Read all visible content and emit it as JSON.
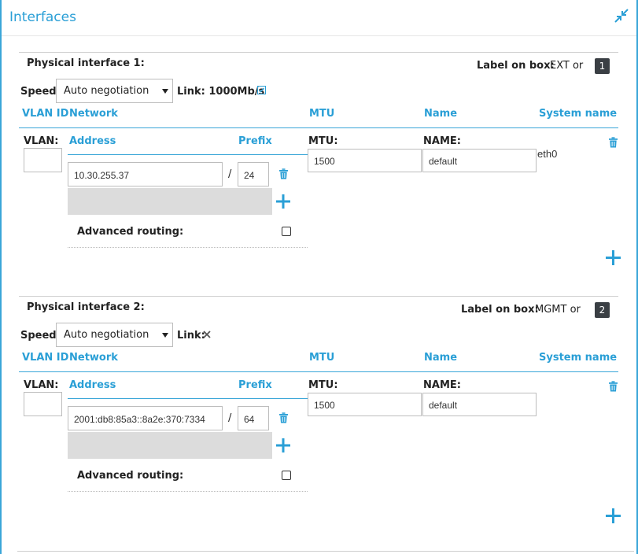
{
  "panel": {
    "title": "Interfaces"
  },
  "columns": {
    "vlan_id": "VLAN ID",
    "network": "Network",
    "mtu": "MTU",
    "name": "Name",
    "system_name": "System name"
  },
  "fields": {
    "vlan": "VLAN:",
    "address": "Address",
    "prefix": "Prefix",
    "mtu": "MTU:",
    "name": "NAME:",
    "speed": "Speed:",
    "link": "Link:",
    "label_on_box": "Label on box:",
    "advanced_routing": "Advanced routing:",
    "slash": "/"
  },
  "interfaces": [
    {
      "title": "Physical interface 1:",
      "label_value": "EXT or",
      "badge": "1",
      "speed": "Auto negotiation",
      "link_text": "1000Mb/s",
      "link_status": "up",
      "vlan": "",
      "address": "10.30.255.37",
      "prefix": "24",
      "mtu": "1500",
      "name": "default",
      "system_name": "eth0",
      "advanced_routing": false
    },
    {
      "title": "Physical interface 2:",
      "label_value": "MGMT or",
      "badge": "2",
      "speed": "Auto negotiation",
      "link_text": "",
      "link_status": "down",
      "vlan": "",
      "address": "2001:db8:85a3::8a2e:370:7334",
      "prefix": "64",
      "mtu": "1500",
      "name": "default",
      "system_name": "",
      "advanced_routing": false
    }
  ],
  "colors": {
    "accent": "#2a9fd6",
    "badge_bg": "#3a3f44",
    "address_pad": "#dcdcdc"
  },
  "icons": [
    "collapse-icon",
    "trash-icon",
    "plus-icon",
    "checkbox-checked-icon",
    "close-icon"
  ]
}
